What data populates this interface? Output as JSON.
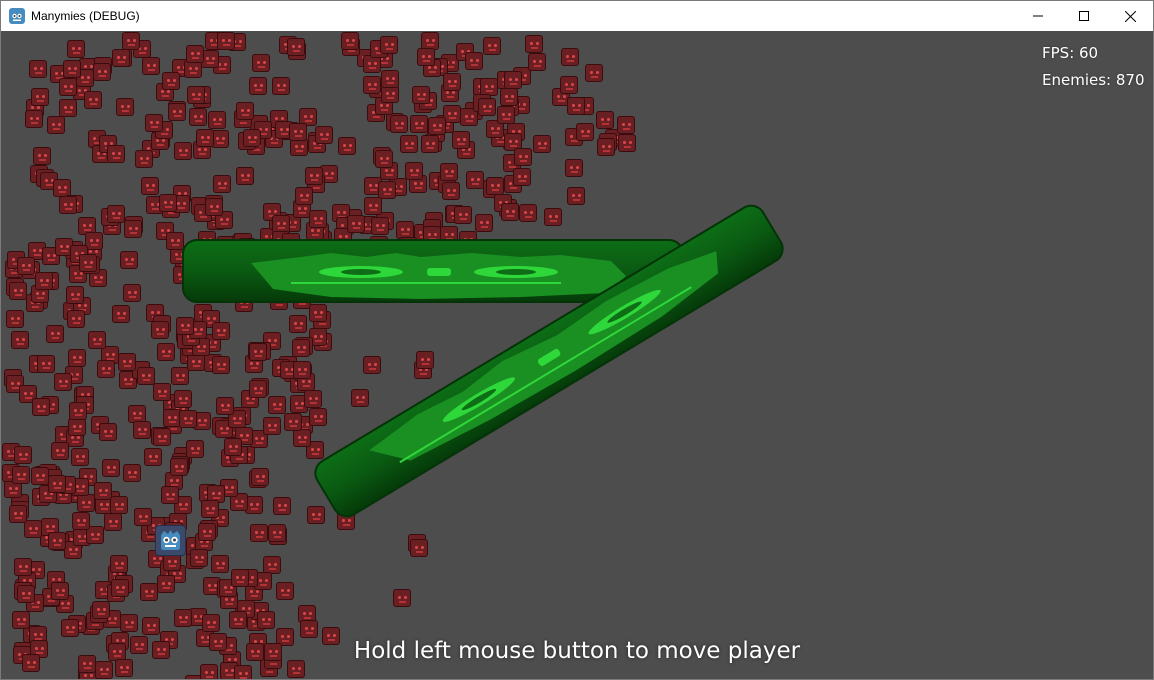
{
  "window": {
    "title": "Manymies (DEBUG)",
    "minimize_icon": "minimize-icon",
    "maximize_icon": "maximize-icon",
    "close_icon": "close-icon"
  },
  "hud": {
    "fps_text": "FPS: 60",
    "enemies_text": "Enemies: 870"
  },
  "hint": "Hold left mouse button to move player",
  "colors": {
    "background": "#4d4d4d",
    "enemy": "#6a1f22",
    "blade": "#0b5e12",
    "blade_glow": "#22c02c",
    "player": "#3b4a6b"
  },
  "icons": {
    "app": "godot-icon",
    "player": "godot-player-icon",
    "enemy": "godot-enemy-icon"
  }
}
